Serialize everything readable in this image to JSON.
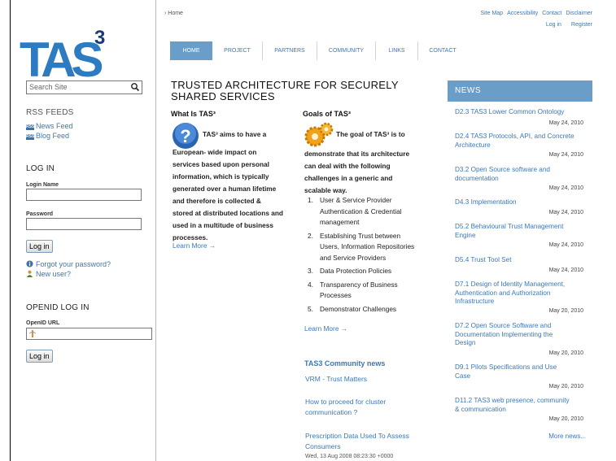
{
  "logo": {
    "text": "TAS",
    "superscript": "3"
  },
  "search": {
    "placeholder": "Search Site"
  },
  "rss": {
    "heading": "RSS FEEDS",
    "rss_badge": "RSS",
    "items": [
      "News Feed",
      "Blog Feed"
    ]
  },
  "login": {
    "heading": "LOG IN",
    "name_label": "Login Name",
    "password_label": "Password",
    "button": "Log in",
    "forgot": "Forgot your password?",
    "new_user": "New user?"
  },
  "openid": {
    "heading": "OPENID LOG IN",
    "url_label": "OpenID URL",
    "button": "Log in"
  },
  "breadcrumb": "Home",
  "top_links": [
    "Site Map",
    "Accessibility",
    "Contact",
    "Disclaimer"
  ],
  "top_links2": [
    "Log in",
    "Register"
  ],
  "nav": [
    "HOME",
    "PROJECT",
    "PARTNERS",
    "COMMUNITY",
    "LINKS",
    "CONTACT"
  ],
  "title": "TRUSTED ARCHITECTURE FOR SECURELY SHARED SERVICES",
  "what": {
    "heading": "What Is TAS³",
    "lines": [
      "TAS³ aims to have a",
      "European- wide impact on",
      "services based upon personal",
      "information, which is typically",
      "generated over a human lifetime",
      "and therefore is collected &",
      "stored at distributed locations and",
      "used in a multitude of business",
      "processes."
    ],
    "learn_more": "Learn More →"
  },
  "goals": {
    "heading": "Goals of TAS³",
    "lines": [
      "The goal of TAS³ is to",
      "demonstrate that its architecture",
      "can deal with the following",
      "challenges in a generic and",
      "scalable way."
    ],
    "items": [
      [
        "User & Service Provider",
        "Authentication & Credential",
        "management"
      ],
      [
        "Establishing Trust between",
        "Users, Information Repositories",
        "and Service Providers"
      ],
      [
        "Data Protection Policies"
      ],
      [
        "Transparency of Business",
        "Processes"
      ],
      [
        "Demonstrator Challenges"
      ]
    ],
    "learn_more": "Learn More →"
  },
  "community": {
    "heading": "TAS3 Community news",
    "items": [
      [
        "VRM - Trust Matters"
      ],
      [
        "How to proceed for cluster",
        "communication ?"
      ],
      [
        "Prescription Data Used To Assess",
        "Consumers"
      ]
    ],
    "date": "Wed, 13 Aug 2008 08:23:30 +0000"
  },
  "news": {
    "heading": "NEWS",
    "items": [
      {
        "title": [
          "D2.3 TAS3 Lower Common Ontology"
        ],
        "date": "May 24, 2010"
      },
      {
        "title": [
          "D2.4 TAS3 Protocols, API, and Concrete",
          "Architecture"
        ],
        "date": "May 24, 2010"
      },
      {
        "title": [
          "D3.2 Open Source software and",
          "documentation"
        ],
        "date": "May 24, 2010"
      },
      {
        "title": [
          "D4.3 Implementation"
        ],
        "date": "May 24, 2010"
      },
      {
        "title": [
          "D5.2 Behavioural Trust Management",
          "Engine"
        ],
        "date": "May 24, 2010"
      },
      {
        "title": [
          "D5.4 Trust Tool Set"
        ],
        "date": "May 24, 2010"
      },
      {
        "title": [
          "D7.1 Design of Identity Management,",
          "Authentication and Authorization",
          "Infrastructure"
        ],
        "date": "May 20, 2010"
      },
      {
        "title": [
          "D7.2 Open Source Software and",
          "Documentation Implementing the",
          "Design"
        ],
        "date": "May 20, 2010"
      },
      {
        "title": [
          "D9.1 Pilots Specifications and Use",
          "Case"
        ],
        "date": "May 20, 2010"
      },
      {
        "title": [
          "D11.2 TAS3 web presence, community",
          "& communication"
        ],
        "date": "May 20, 2010"
      }
    ],
    "more": "More news..."
  }
}
